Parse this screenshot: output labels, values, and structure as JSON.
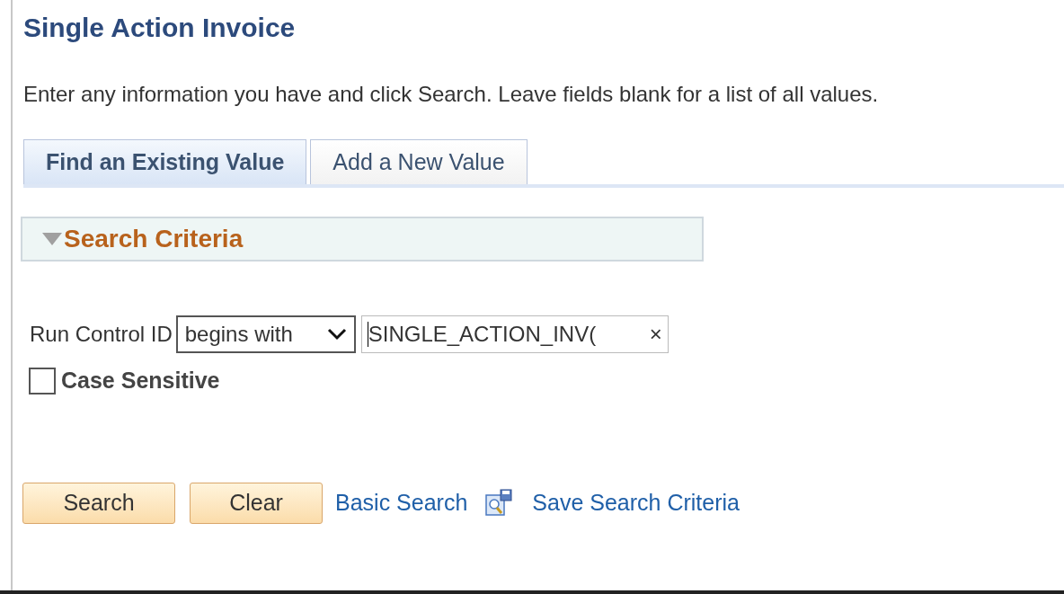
{
  "page": {
    "title": "Single Action Invoice",
    "instructions": "Enter any information you have and click Search. Leave fields blank for a list of all values."
  },
  "tabs": [
    {
      "label": "Find an Existing Value",
      "selected": true
    },
    {
      "label": "Add a New Value",
      "selected": false
    }
  ],
  "section": {
    "title": "Search Criteria",
    "expanded": true
  },
  "criteria": {
    "label": "Run Control ID",
    "operator": "begins with",
    "value": "SINGLE_ACTION_INV(",
    "clear": "×"
  },
  "case_sensitive": {
    "label": "Case Sensitive",
    "checked": false
  },
  "actions": [
    {
      "kind": "button",
      "label": "Search"
    },
    {
      "kind": "button",
      "label": "Clear"
    },
    {
      "kind": "link",
      "label": "Basic Search"
    },
    {
      "kind": "icon-link",
      "label": "Save Search Criteria"
    }
  ]
}
